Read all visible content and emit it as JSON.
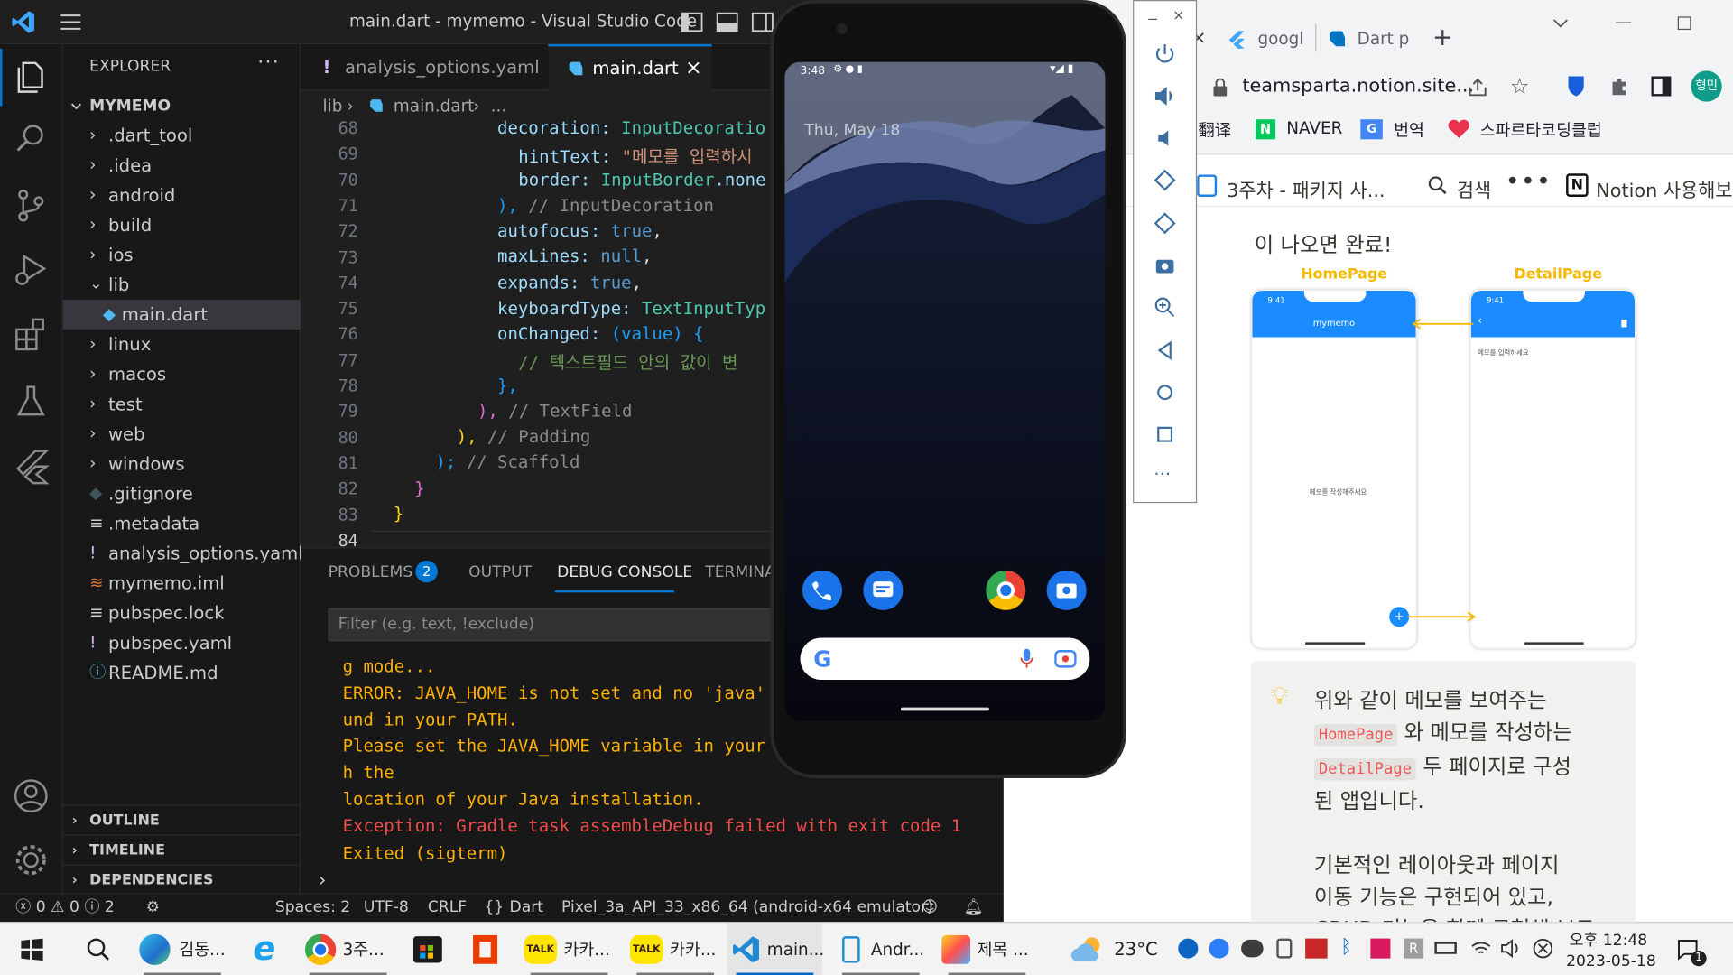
{
  "vscode": {
    "title": "main.dart - mymemo - Visual Studio Code",
    "explorer_title": "EXPLORER",
    "project": "MYMEMO",
    "tree": [
      ".dart_tool",
      ".idea",
      "android",
      "build",
      "ios",
      "lib",
      "main.dart",
      "linux",
      "macos",
      "test",
      "web",
      "windows",
      ".gitignore",
      ".metadata",
      "analysis_options.yaml",
      "mymemo.iml",
      "pubspec.lock",
      "pubspec.yaml",
      "README.md"
    ],
    "sections": [
      "OUTLINE",
      "TIMELINE",
      "DEPENDENCIES"
    ],
    "tabs": [
      "analysis_options.yaml",
      "main.dart"
    ],
    "breadcrumb": [
      "lib",
      "main.dart",
      "..."
    ],
    "line_numbers": [
      "68",
      "69",
      "70",
      "71",
      "72",
      "73",
      "74",
      "75",
      "76",
      "77",
      "78",
      "79",
      "80",
      "81",
      "82",
      "83",
      "84"
    ],
    "code": {
      "l68a": "decoration: ",
      "l68b": "InputDecoratio",
      "l69a": "hintText: ",
      "l69b": "\"메모를 입력하시",
      "l70a": "border: ",
      "l70b": "InputBorder",
      "l70c": ".none",
      "l71a": "), ",
      "l71b": "// InputDecoration",
      "l72a": "autofocus: ",
      "l72b": "true",
      "l72c": ",",
      "l73a": "maxLines: ",
      "l73b": "null",
      "l73c": ",",
      "l74a": "expands: ",
      "l74b": "true",
      "l74c": ",",
      "l75a": "keyboardType: ",
      "l75b": "TextInputTyp",
      "l76a": "onChanged: ",
      "l76b": "(value) {",
      "l77": "// 텍스트필드 안의 값이 변",
      "l78": "},",
      "l79a": "), ",
      "l79b": "// TextField",
      "l80a": "), ",
      "l80b": "// Padding",
      "l81a": "); ",
      "l81b": "// Scaffold",
      "l82": "}",
      "l83": "}"
    },
    "panel_tabs": [
      "PROBLEMS",
      "OUTPUT",
      "DEBUG CONSOLE",
      "TERMINA"
    ],
    "problems_count": "2",
    "filter_placeholder": "Filter (e.g. text, !exclude)",
    "console": [
      "g mode...",
      "ERROR: JAVA_HOME is not set and no 'java'",
      "und in your PATH.",
      "Please set the JAVA_HOME variable in your",
      "h the",
      "location of your Java installation.",
      "Exception: Gradle task assembleDebug failed with exit code 1",
      "Exited (sigterm)"
    ],
    "status": {
      "errors": "0",
      "warnings": "0",
      "info": "2",
      "spaces": "Spaces: 2",
      "encoding": "UTF-8",
      "eol": "CRLF",
      "lang": "Dart",
      "device": "Pixel_3a_API_33_x86_64 (android-x64 emulator)"
    }
  },
  "phone": {
    "time": "3:48",
    "date": "Thu, May 18"
  },
  "browser": {
    "tabs": [
      "googl",
      "Dart p"
    ],
    "url": "teamsparta.notion.site...",
    "profile": "형민",
    "bookmarks": [
      "翻译",
      "NAVER",
      "번역",
      "스파르타코딩클럽"
    ],
    "notion_page": "3주차 - 패키지 사...",
    "notion_search": "검색",
    "notion_more": "Notion 사용해보",
    "text_top": "이 나오면 완료!",
    "diagram_left_title": "HomePage",
    "diagram_right_title": "DetailPage",
    "mini_time": "9:41",
    "mini_appbar": "mymemo",
    "mini_hint": "메모를 입력하세요",
    "mini_empty": "메모를 작성해주세요",
    "callout": {
      "l1": "위와 같이 메모를 보여주는",
      "code1": "HomePage",
      "l2": " 와 메모를 작성하는",
      "code2": "DetailPage",
      "l3": " 두 페이지로 구성",
      "l4": "된 앱입니다.",
      "l5": "기본적인 레이아웃과 페이지",
      "l6": "이동 기능은 구현되어 있고,",
      "l7": "CRUD 기능을 함께 구현해 보도"
    }
  },
  "taskbar": {
    "apps": [
      "김동...",
      "3주...",
      "카카...",
      "카카...",
      "main...",
      "Andr...",
      "제목 ..."
    ],
    "weather": "23°C",
    "time_l1": "오후 12:48",
    "time_l2": "2023-05-18",
    "notif": "1"
  },
  "colors": {
    "vscode_blue": "#0078d4",
    "error_red": "#f14c4c",
    "warn_orange": "#ffb000",
    "mini_blue": "#1a8cff"
  }
}
